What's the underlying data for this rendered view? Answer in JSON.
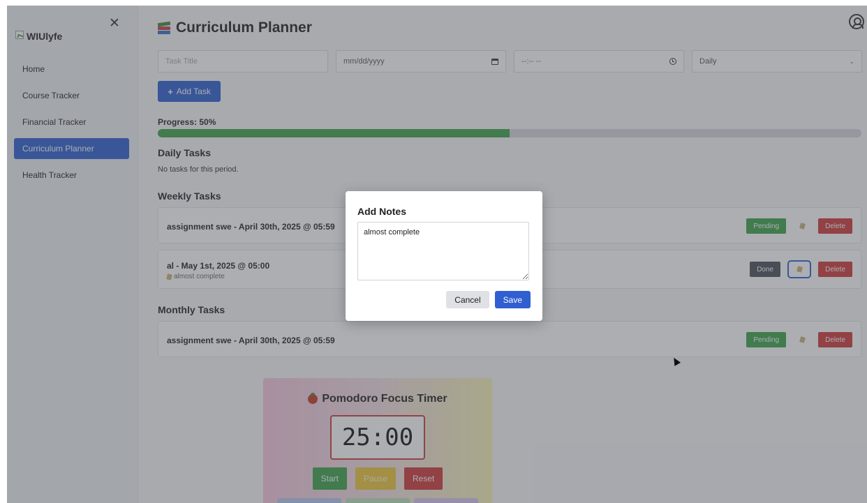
{
  "sidebar": {
    "brand": "WIUlyfe",
    "items": [
      {
        "label": "Home"
      },
      {
        "label": "Course Tracker"
      },
      {
        "label": "Financial Tracker"
      },
      {
        "label": "Curriculum Planner",
        "active": true
      },
      {
        "label": "Health Tracker"
      }
    ]
  },
  "header": {
    "title": "Curriculum Planner"
  },
  "form": {
    "title_placeholder": "Task Title",
    "date_placeholder": "mm/dd/yyyy",
    "time_placeholder": "--:-- --",
    "frequency_value": "Daily",
    "add_button": "Add Task"
  },
  "progress": {
    "label": "Progress: 50%",
    "value": 0.5
  },
  "daily": {
    "title": "Daily Tasks",
    "empty": "No tasks for this period."
  },
  "weekly": {
    "title": "Weekly Tasks",
    "tasks": [
      {
        "text": "assignment swe - April 30th, 2025 @ 05:59",
        "note": "",
        "status": "Pending"
      },
      {
        "text": "al - May 1st, 2025 @ 05:00",
        "note": "almost complete",
        "status": "Done"
      }
    ]
  },
  "monthly": {
    "title": "Monthly Tasks",
    "tasks": [
      {
        "text": "assignment swe - April 30th, 2025 @ 05:59",
        "note": "",
        "status": "Pending"
      }
    ]
  },
  "delete_label": "Delete",
  "pomodoro": {
    "title": "Pomodoro Focus Timer",
    "time": "25:00",
    "start": "Start",
    "pause": "Pause",
    "reset": "Reset"
  },
  "modal": {
    "title": "Add Notes",
    "text": "almost complete",
    "cancel": "Cancel",
    "save": "Save"
  },
  "colors": {
    "primary": "#2f5fd0",
    "success": "#3ca24a",
    "danger": "#d03a3a",
    "muted": "#4b5058"
  }
}
